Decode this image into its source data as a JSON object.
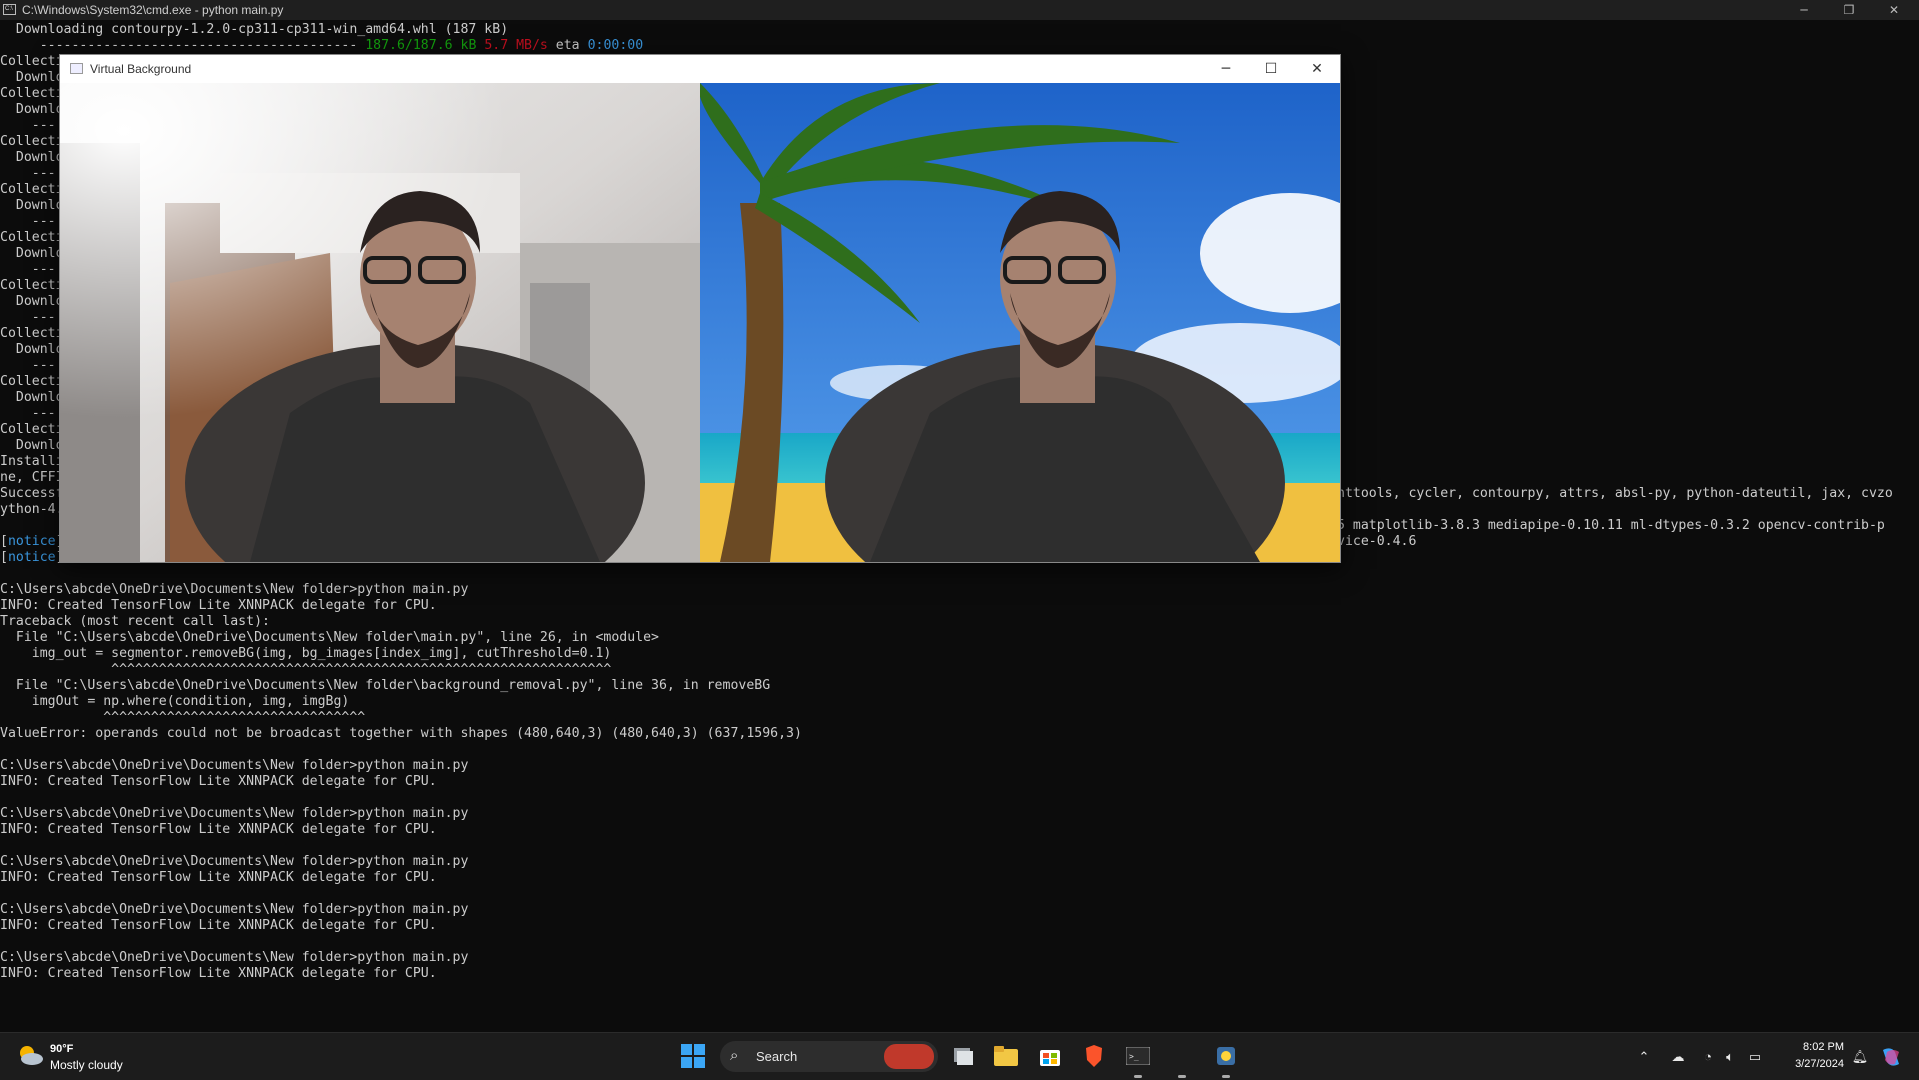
{
  "console": {
    "title": "C:\\Windows\\System32\\cmd.exe - python  main.py",
    "lines_top": [
      {
        "t": "  Downloading contourpy-1.2.0-cp311-cp311-win_amd64.whl (187 kB)"
      },
      {
        "t": "     ---------------------------------------- ",
        "g": "187.6/187.6 kB",
        "r": " 5.7 MB/s",
        "e": " eta ",
        "c": "0:00:00"
      }
    ],
    "lines_left": [
      "Collecti",
      "  Downlo",
      "Collecti",
      "  Downlo",
      "    ---",
      "Collecti",
      "  Downlo",
      "    ---",
      "Collecti",
      "  Downlo",
      "    ---",
      "Collecti",
      "  Downlo",
      "    ---",
      "Collecti",
      "  Downlo",
      "    ---",
      "Collecti",
      "  Downlo",
      "    ---",
      "Collecti",
      "  Downlo",
      "    ---",
      "Collecti",
      "  Downlo",
      "Installi",
      "ne, CFFI",
      "Successf",
      "ython-4."
    ],
    "lines_right": [
      {
        "row": 27,
        "t": "nttools, cycler, contourpy, attrs, absl-py, python-dateutil, jax, cvzo"
      },
      {
        "row": 29,
        "t": "5 matplotlib-3.8.3 mediapipe-0.10.11 ml-dtypes-0.3.2 opencv-contrib-p"
      },
      {
        "row": 30,
        "t": "vice-0.4.6"
      }
    ],
    "notices": [
      "notice",
      "notice"
    ],
    "lines_bottom": [
      "",
      "C:\\Users\\abcde\\OneDrive\\Documents\\New folder>python main.py",
      "INFO: Created TensorFlow Lite XNNPACK delegate for CPU.",
      "Traceback (most recent call last):",
      "  File \"C:\\Users\\abcde\\OneDrive\\Documents\\New folder\\main.py\", line 26, in <module>",
      "    img_out = segmentor.removeBG(img, bg_images[index_img], cutThreshold=0.1)",
      "              ^^^^^^^^^^^^^^^^^^^^^^^^^^^^^^^^^^^^^^^^^^^^^^^^^^^^^^^^^^^^^^^",
      "  File \"C:\\Users\\abcde\\OneDrive\\Documents\\New folder\\background_removal.py\", line 36, in removeBG",
      "    imgOut = np.where(condition, img, imgBg)",
      "             ^^^^^^^^^^^^^^^^^^^^^^^^^^^^^^^^^",
      "ValueError: operands could not be broadcast together with shapes (480,640,3) (480,640,3) (637,1596,3)",
      "",
      "C:\\Users\\abcde\\OneDrive\\Documents\\New folder>python main.py",
      "INFO: Created TensorFlow Lite XNNPACK delegate for CPU.",
      "",
      "C:\\Users\\abcde\\OneDrive\\Documents\\New folder>python main.py",
      "INFO: Created TensorFlow Lite XNNPACK delegate for CPU.",
      "",
      "C:\\Users\\abcde\\OneDrive\\Documents\\New folder>python main.py",
      "INFO: Created TensorFlow Lite XNNPACK delegate for CPU.",
      "",
      "C:\\Users\\abcde\\OneDrive\\Documents\\New folder>python main.py",
      "INFO: Created TensorFlow Lite XNNPACK delegate for CPU.",
      "",
      "C:\\Users\\abcde\\OneDrive\\Documents\\New folder>python main.py",
      "INFO: Created TensorFlow Lite XNNPACK delegate for CPU."
    ]
  },
  "video_window": {
    "title": "Virtual Background",
    "minimize": "─",
    "maximize": "☐",
    "close": "✕"
  },
  "window_controls": {
    "minimize": "─",
    "restore": "❐",
    "close": "✕"
  },
  "taskbar": {
    "weather": {
      "temp": "90°F",
      "desc": "Mostly cloudy"
    },
    "search_placeholder": "Search",
    "time": "8:02 PM",
    "date": "3/27/2024"
  },
  "colors": {
    "console_bg": "#0c0c0c",
    "console_text": "#cccccc",
    "green": "#13a10e",
    "red": "#c50f1f",
    "cyan": "#3a96dd",
    "taskbar": "#1c1c1c"
  }
}
